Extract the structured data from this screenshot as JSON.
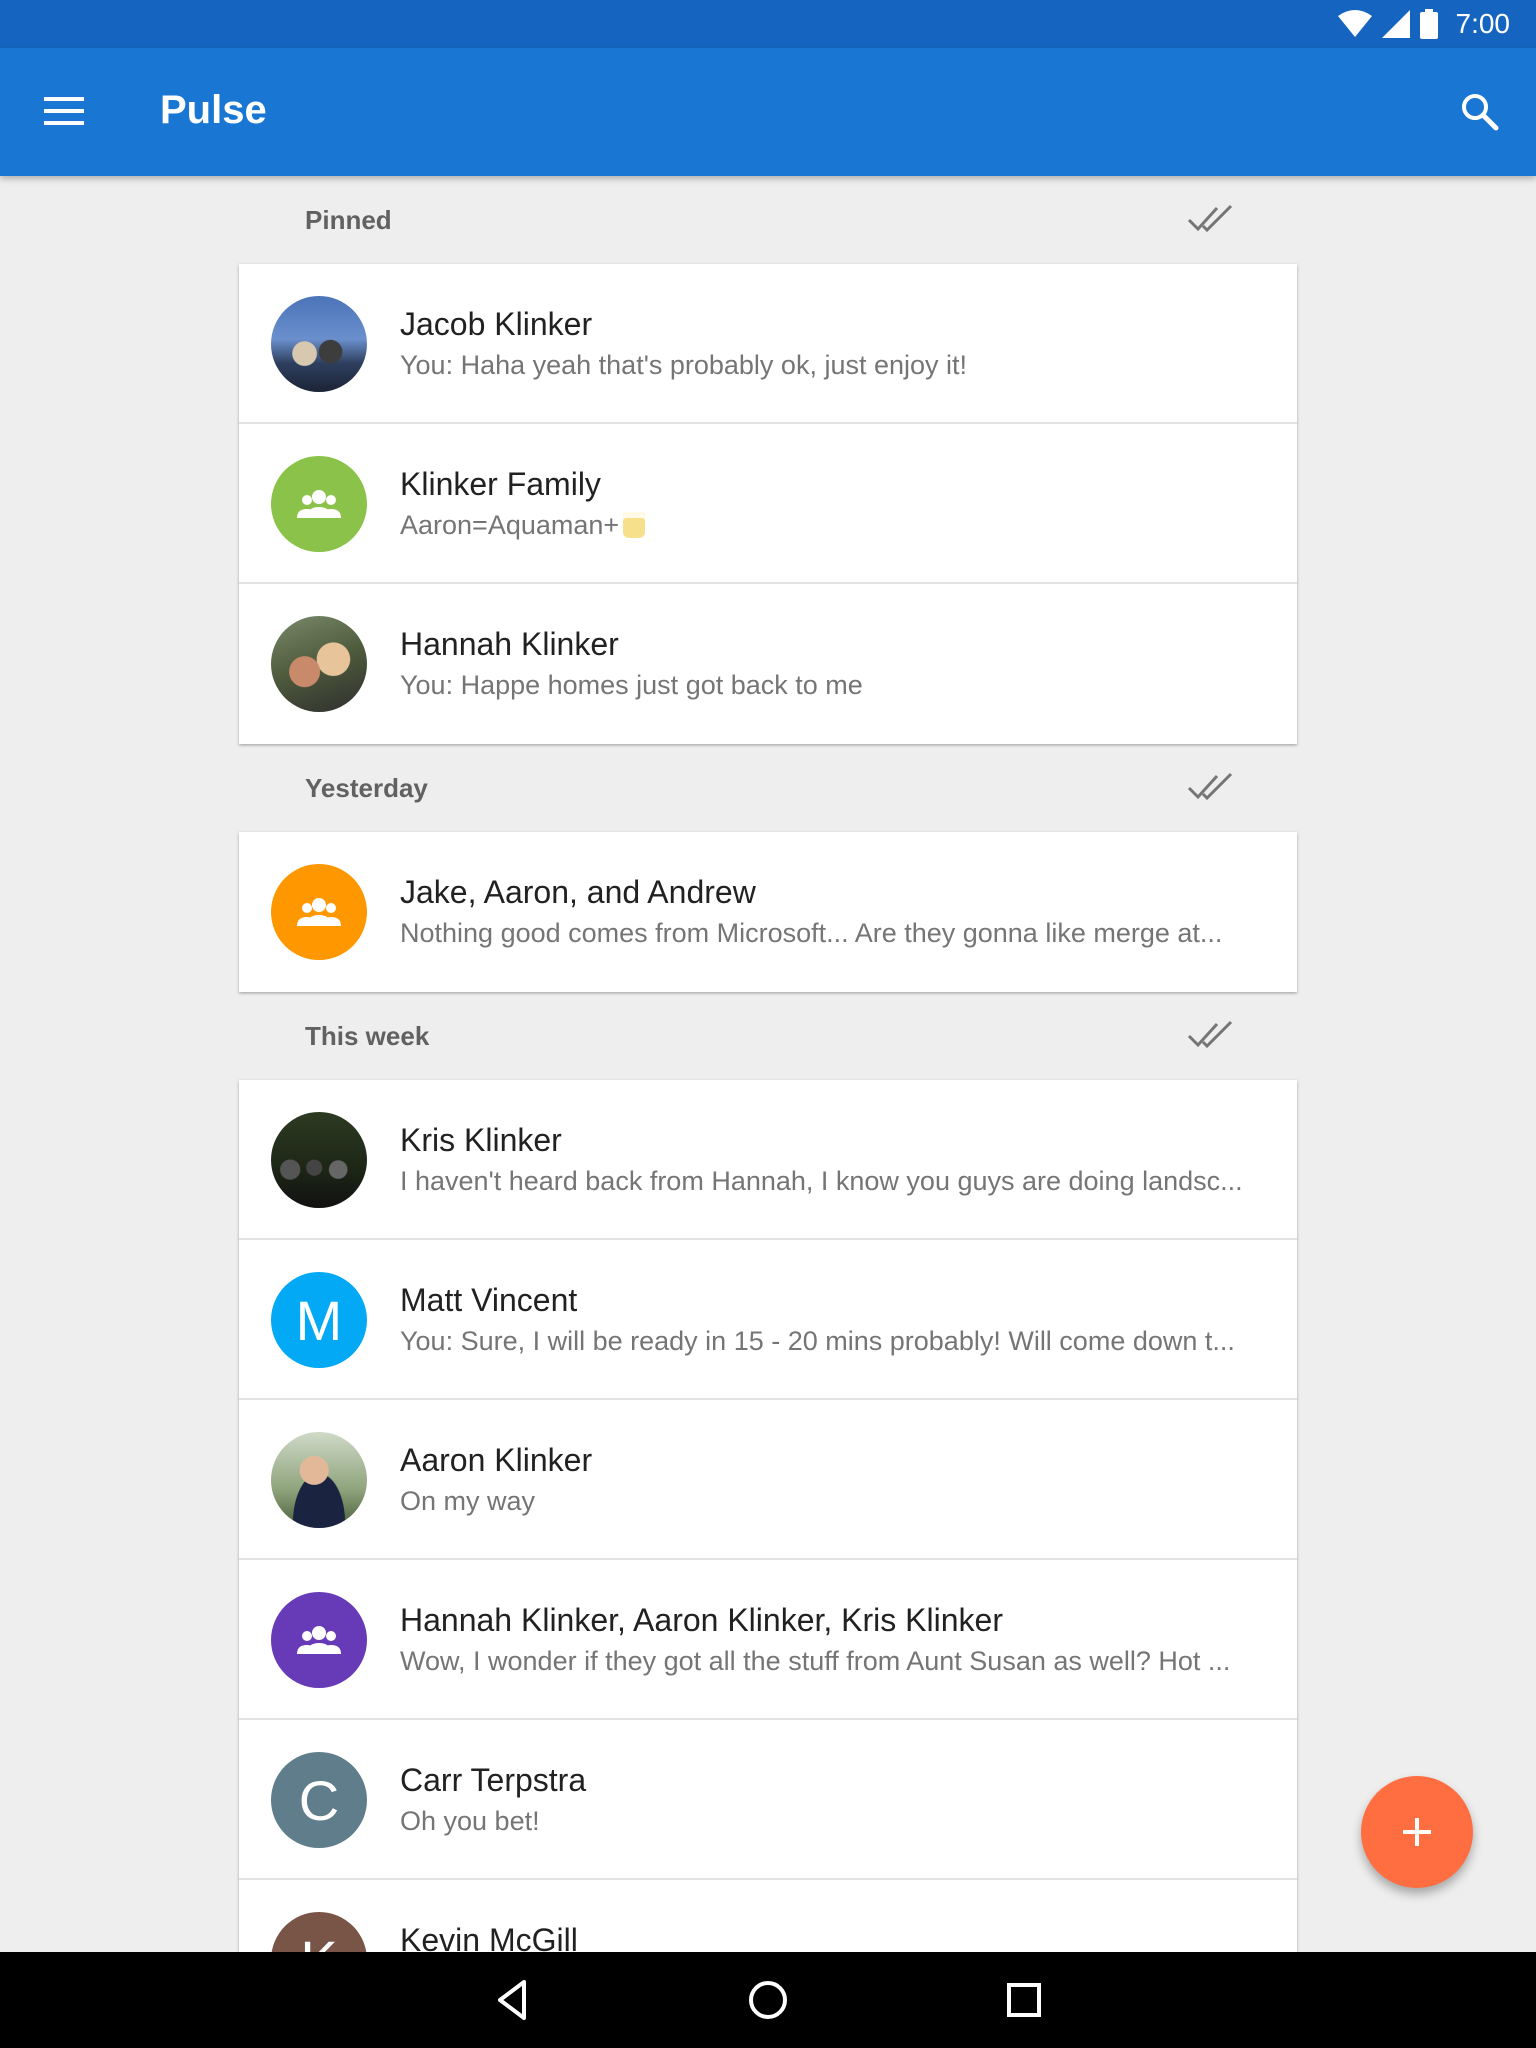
{
  "status_bar": {
    "time": "7:00"
  },
  "app_bar": {
    "title": "Pulse"
  },
  "sections": [
    {
      "title": "Pinned",
      "conversations": [
        {
          "name": "Jacob Klinker",
          "snippet": "You: Haha yeah that's probably ok, just enjoy it!",
          "avatar": "photo1"
        },
        {
          "name": "Klinker Family",
          "snippet": "Aaron=Aquaman+",
          "avatar": "group",
          "avatar_color": "#8bc34a"
        },
        {
          "name": "Hannah Klinker",
          "snippet": "You: Happe homes just got back to me",
          "avatar": "photo2"
        }
      ]
    },
    {
      "title": "Yesterday",
      "conversations": [
        {
          "name": "Jake, Aaron, and Andrew",
          "snippet": "Nothing good comes from Microsoft... Are they gonna like merge at...",
          "avatar": "group",
          "avatar_color": "#ff9800"
        }
      ]
    },
    {
      "title": "This week",
      "conversations": [
        {
          "name": "Kris Klinker",
          "snippet": "I haven't heard back from Hannah, I know you guys are doing landsc...",
          "avatar": "photo3"
        },
        {
          "name": "Matt Vincent",
          "snippet": "You: Sure, I will be ready in 15 - 20 mins probably! Will come down t...",
          "avatar": "letter",
          "letter": "M",
          "avatar_color": "#03a9f4"
        },
        {
          "name": "Aaron Klinker",
          "snippet": "On my way",
          "avatar": "photo4"
        },
        {
          "name": "Hannah Klinker, Aaron Klinker, Kris Klinker",
          "snippet": "Wow, I wonder if they got all the stuff from Aunt Susan as well? Hot ...",
          "avatar": "group",
          "avatar_color": "#673ab7"
        },
        {
          "name": "Carr Terpstra",
          "snippet": "Oh you bet!",
          "avatar": "letter",
          "letter": "C",
          "avatar_color": "#607d8b"
        },
        {
          "name": "Kevin McGill",
          "snippet": "",
          "avatar": "letter",
          "letter": "K",
          "avatar_color": "#795548"
        }
      ]
    }
  ],
  "icons": {
    "menu": "menu-icon",
    "search": "search-icon",
    "mark_read": "double-check-icon",
    "group": "group-icon",
    "compose": "plus-icon",
    "back": "back-triangle-icon",
    "home": "home-circle-icon",
    "recents": "recents-square-icon"
  },
  "colors": {
    "status_bar": "#1565c0",
    "app_bar": "#1976d2",
    "fab": "#ff6e40",
    "background": "#eeeeee"
  }
}
